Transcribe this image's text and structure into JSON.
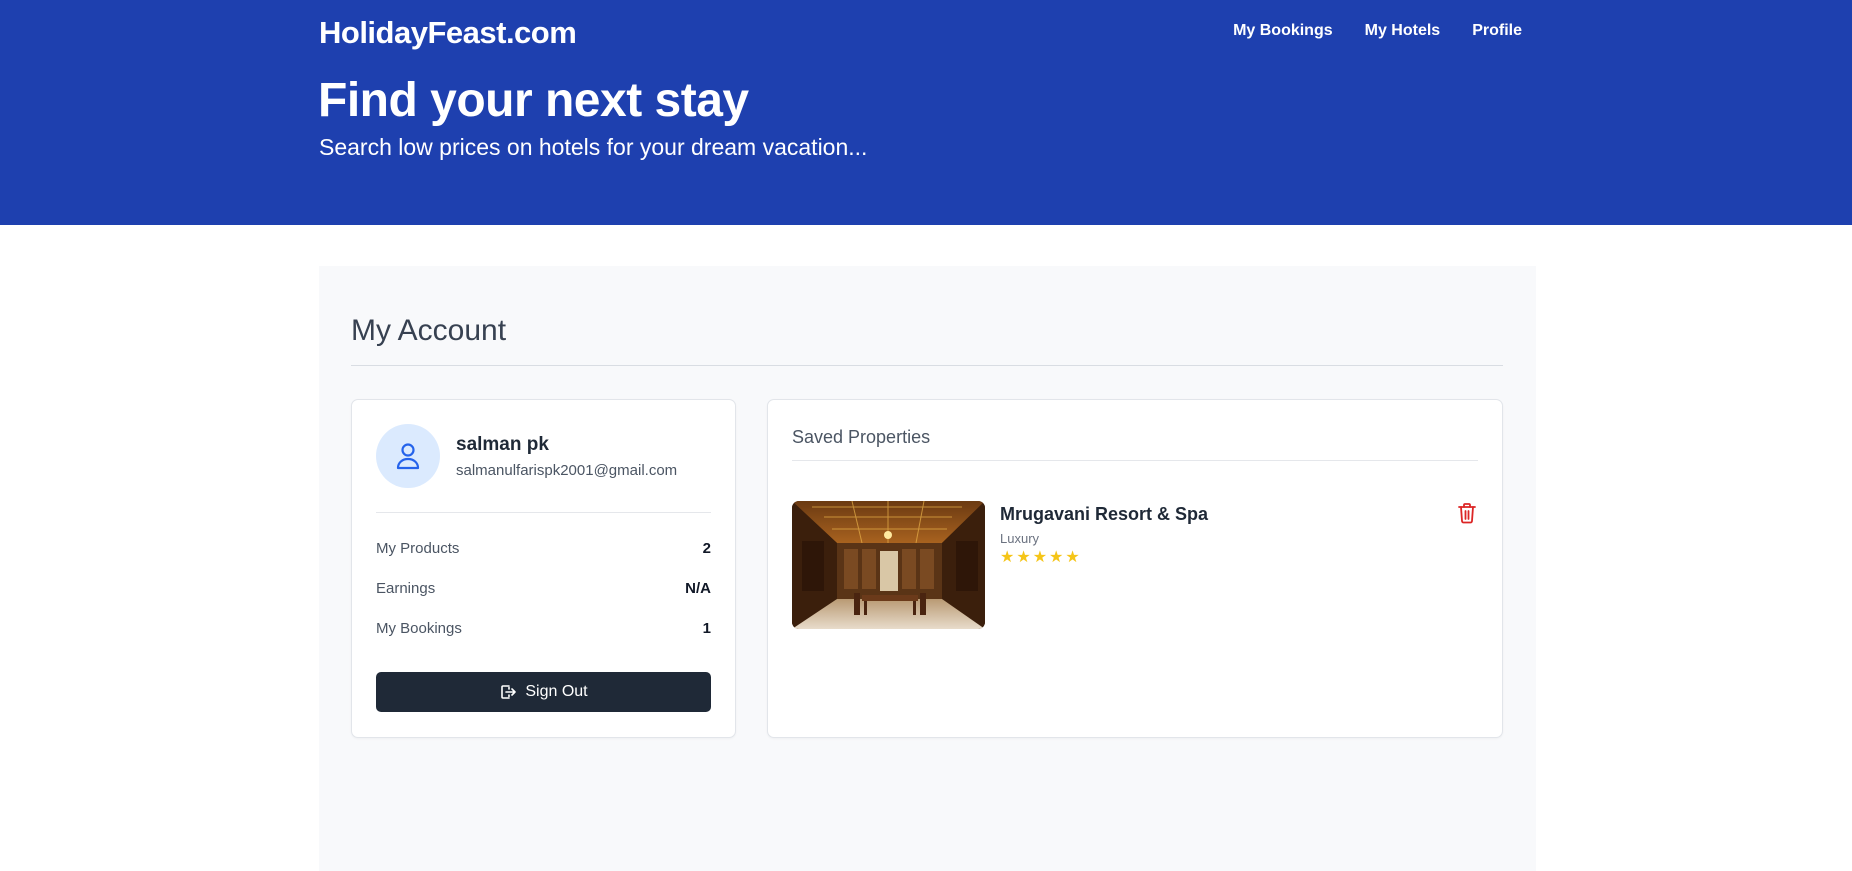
{
  "header": {
    "brand": "HolidayFeast.com",
    "nav": [
      {
        "label": "My Bookings"
      },
      {
        "label": "My Hotels"
      },
      {
        "label": "Profile"
      }
    ],
    "title": "Find your next stay",
    "subtitle": "Search low prices on hotels for your dream vacation..."
  },
  "account": {
    "title": "My Account",
    "user": {
      "name": "salman pk",
      "email": "salmanulfarispk2001@gmail.com",
      "avatar_icon": "user-icon"
    },
    "stats": [
      {
        "label": "My Products",
        "value": "2"
      },
      {
        "label": "Earnings",
        "value": "N/A"
      },
      {
        "label": "My Bookings",
        "value": "1"
      }
    ],
    "signout_label": "Sign Out",
    "signout_icon": "logout-icon"
  },
  "saved": {
    "title": "Saved Properties",
    "properties": [
      {
        "name": "Mrugavani Resort & Spa",
        "type": "Luxury",
        "rating": 5,
        "delete_icon": "trash-icon"
      }
    ]
  },
  "colors": {
    "brand_blue": "#1e40af",
    "dark_button": "#1f2937",
    "star": "#f5c518",
    "danger": "#dc2626",
    "avatar_bg": "#dbeafe"
  }
}
